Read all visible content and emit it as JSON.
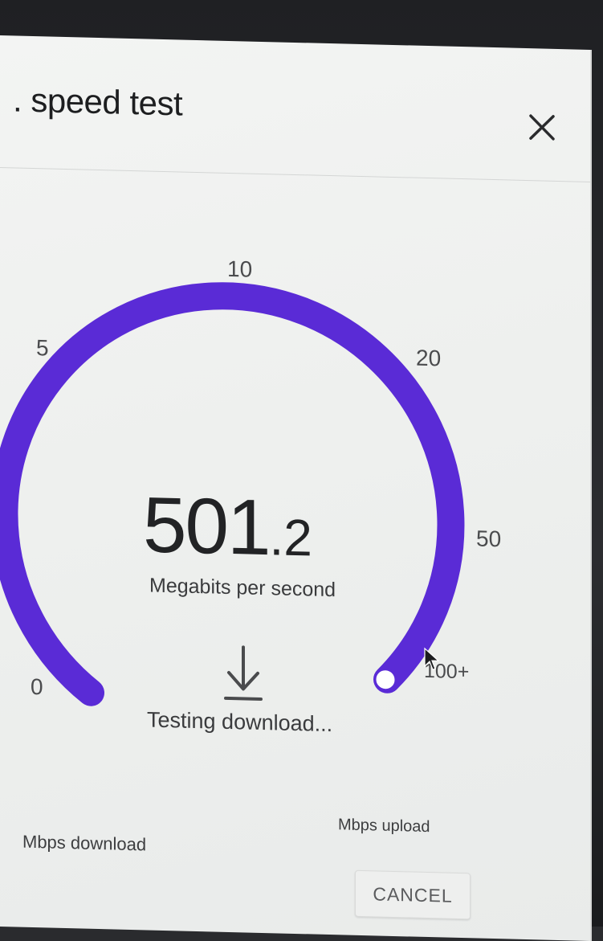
{
  "dialog": {
    "title": ". speed test",
    "close_icon": "close-icon"
  },
  "gauge": {
    "ticks": [
      "0",
      "5",
      "10",
      "20",
      "50",
      "100+"
    ],
    "progress_fraction": 1.0,
    "colors": {
      "arc": "#5a2bd6",
      "knob_fill": "#ffffff"
    }
  },
  "result": {
    "speed_int": "501",
    "speed_dec": ".2",
    "unit": "Megabits per second",
    "status_icon": "download-arrow-icon",
    "status": "Testing download..."
  },
  "footer": {
    "download_label": "Mbps download",
    "upload_label": "Mbps upload",
    "cancel_label": "CANCEL"
  }
}
